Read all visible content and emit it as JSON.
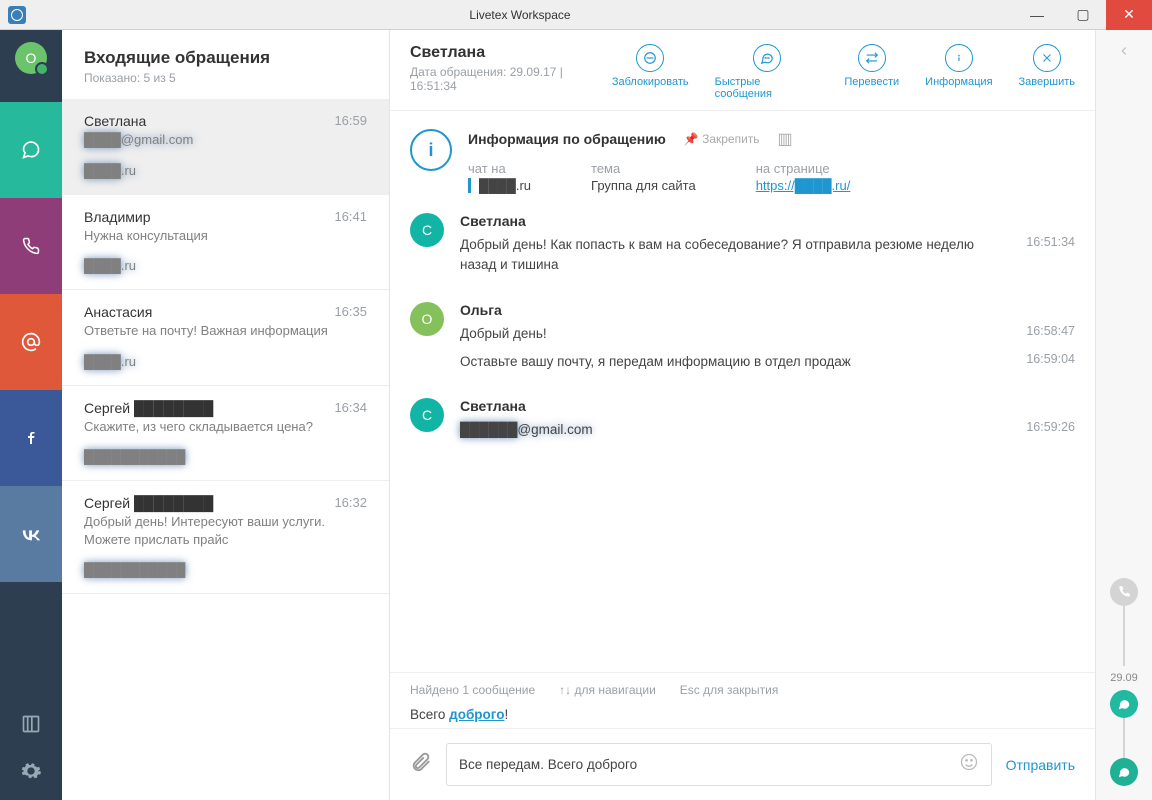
{
  "window": {
    "title": "Livetex Workspace"
  },
  "rail": {
    "avatar_initial": "О"
  },
  "sidebar": {
    "title": "Входящие обращения",
    "subtitle": "Показано: 5 из 5",
    "items": [
      {
        "name": "Светлана",
        "time": "16:59",
        "preview": "████@gmail.com",
        "site": "████.ru",
        "selected": true,
        "preview_blur": true
      },
      {
        "name": "Владимир",
        "time": "16:41",
        "preview": "Нужна консультация",
        "site": "████.ru"
      },
      {
        "name": "Анастасия",
        "time": "16:35",
        "preview": "Ответьте на почту! Важная информация",
        "site": "████.ru"
      },
      {
        "name": "Сергей ████████",
        "time": "16:34",
        "preview": "Скажите, из чего складывается цена?",
        "site": "███████████"
      },
      {
        "name": "Сергей ████████",
        "time": "16:32",
        "preview": "Добрый день! Интересуют ваши услуги. Можете прислать прайс",
        "site": "███████████"
      }
    ]
  },
  "header": {
    "contact": "Светлана",
    "meta": "Дата обращения: 29.09.17 | 16:51:34",
    "actions": {
      "block": "Заблокировать",
      "quick": "Быстрые сообщения",
      "transfer": "Перевести",
      "info": "Информация",
      "close": "Завершить"
    }
  },
  "info_card": {
    "title": "Информация по обращению",
    "pin": "Закрепить",
    "cols": {
      "chat_lbl": "чат на",
      "chat_val": "████.ru",
      "topic_lbl": "тема",
      "topic_val": "Группа для сайта",
      "page_lbl": "на странице",
      "page_val": "https://████.ru/"
    }
  },
  "messages": [
    {
      "author": "Светлана",
      "initial": "С",
      "color": "cyan",
      "lines": [
        {
          "text": "Добрый день! Как попасть к вам на собеседование? Я отправила резюме неделю назад и тишина",
          "time": "16:51:34"
        }
      ]
    },
    {
      "author": "Ольга",
      "initial": "О",
      "color": "green",
      "lines": [
        {
          "text": "Добрый день!",
          "time": "16:58:47"
        },
        {
          "text": "Оставьте вашу почту, я передам информацию в отдел продаж",
          "time": "16:59:04"
        }
      ]
    },
    {
      "author": "Светлана",
      "initial": "С",
      "color": "cyan",
      "lines": [
        {
          "text": "██████@gmail.com",
          "time": "16:59:26",
          "blur": true
        }
      ]
    }
  ],
  "search": {
    "found": "Найдено 1 сообщение",
    "nav_hint": "для навигации",
    "esc_hint": "Esc для закрытия",
    "result_prefix": "Всего ",
    "result_highlight": "доброго",
    "result_suffix": "!"
  },
  "compose": {
    "value": "Все передам. Всего доброго",
    "send": "Отправить"
  },
  "rightrail": {
    "date": "29.09"
  }
}
